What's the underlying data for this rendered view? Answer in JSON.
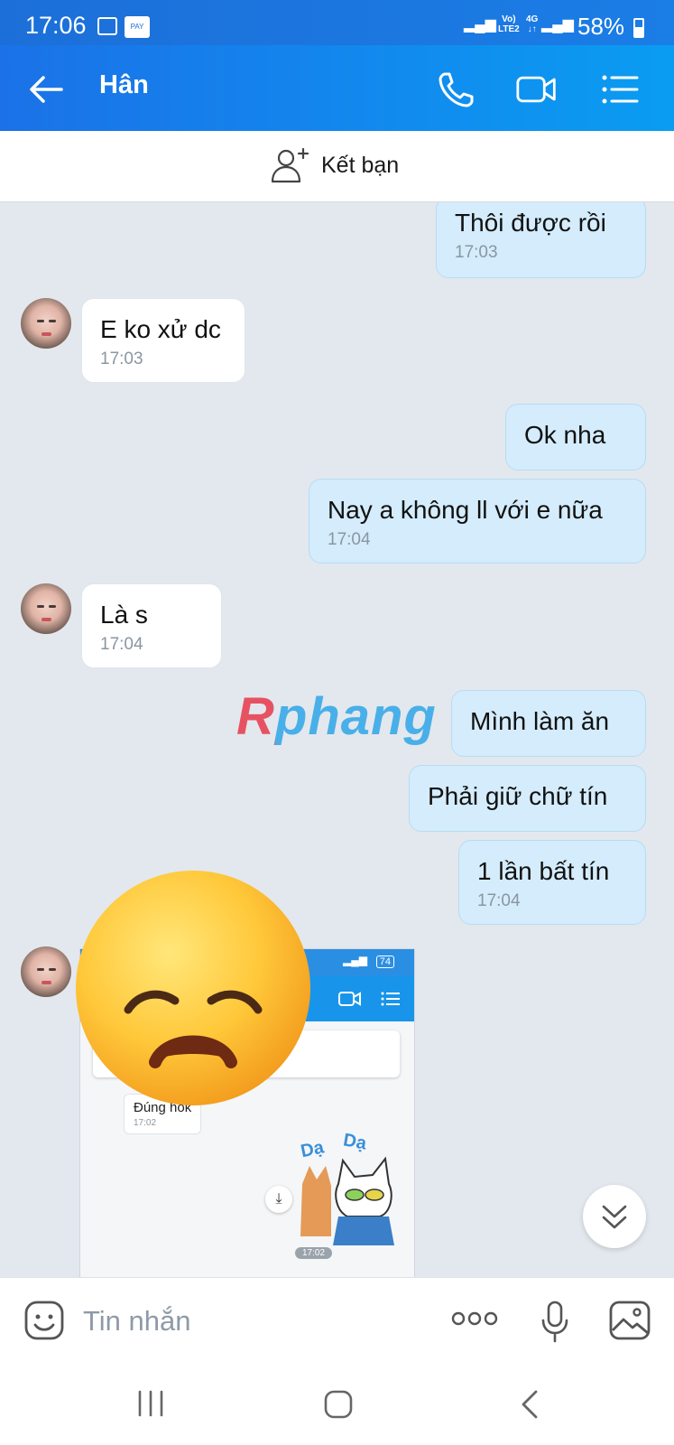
{
  "status_bar": {
    "time": "17:06",
    "pay_label": "PAY",
    "network_1": "Vo)\nLTE2",
    "network_2": "4G",
    "battery": "58%"
  },
  "header": {
    "contact_name": "Hân",
    "icons": [
      "back-arrow-icon",
      "phone-icon",
      "video-call-icon",
      "menu-list-icon"
    ]
  },
  "friend_bar": {
    "label": "Kết bạn"
  },
  "messages": [
    {
      "side": "out",
      "text": "Thôi được rồi",
      "time": "17:03"
    },
    {
      "side": "in",
      "text": "E ko xử dc",
      "time": "17:03"
    },
    {
      "side": "out",
      "text": "Ok nha",
      "time": ""
    },
    {
      "side": "out",
      "text": "Nay a không ll với e nữa",
      "time": "17:04"
    },
    {
      "side": "in",
      "text": "Là s",
      "time": "17:04"
    },
    {
      "side": "out",
      "text": "Mình làm ăn",
      "time": ""
    },
    {
      "side": "out",
      "text": "Phải giữ chữ tín",
      "time": ""
    },
    {
      "side": "out",
      "text": "1 lần bất tín",
      "time": "17:04"
    }
  ],
  "image_message": {
    "inner_bubble_text": "Đúng hok",
    "inner_bubble_time": "17:02",
    "sticker_text": "Dạ Dạ",
    "sticker_time": "17:02",
    "inner_status": "74"
  },
  "watermark": "Rphang",
  "input_bar": {
    "placeholder": "Tin nhắn"
  },
  "colors": {
    "header_start": "#1b72e8",
    "header_end": "#0a9cf2",
    "outgoing_bubble": "#d4ecfb",
    "chat_bg": "#e3e8ee"
  }
}
